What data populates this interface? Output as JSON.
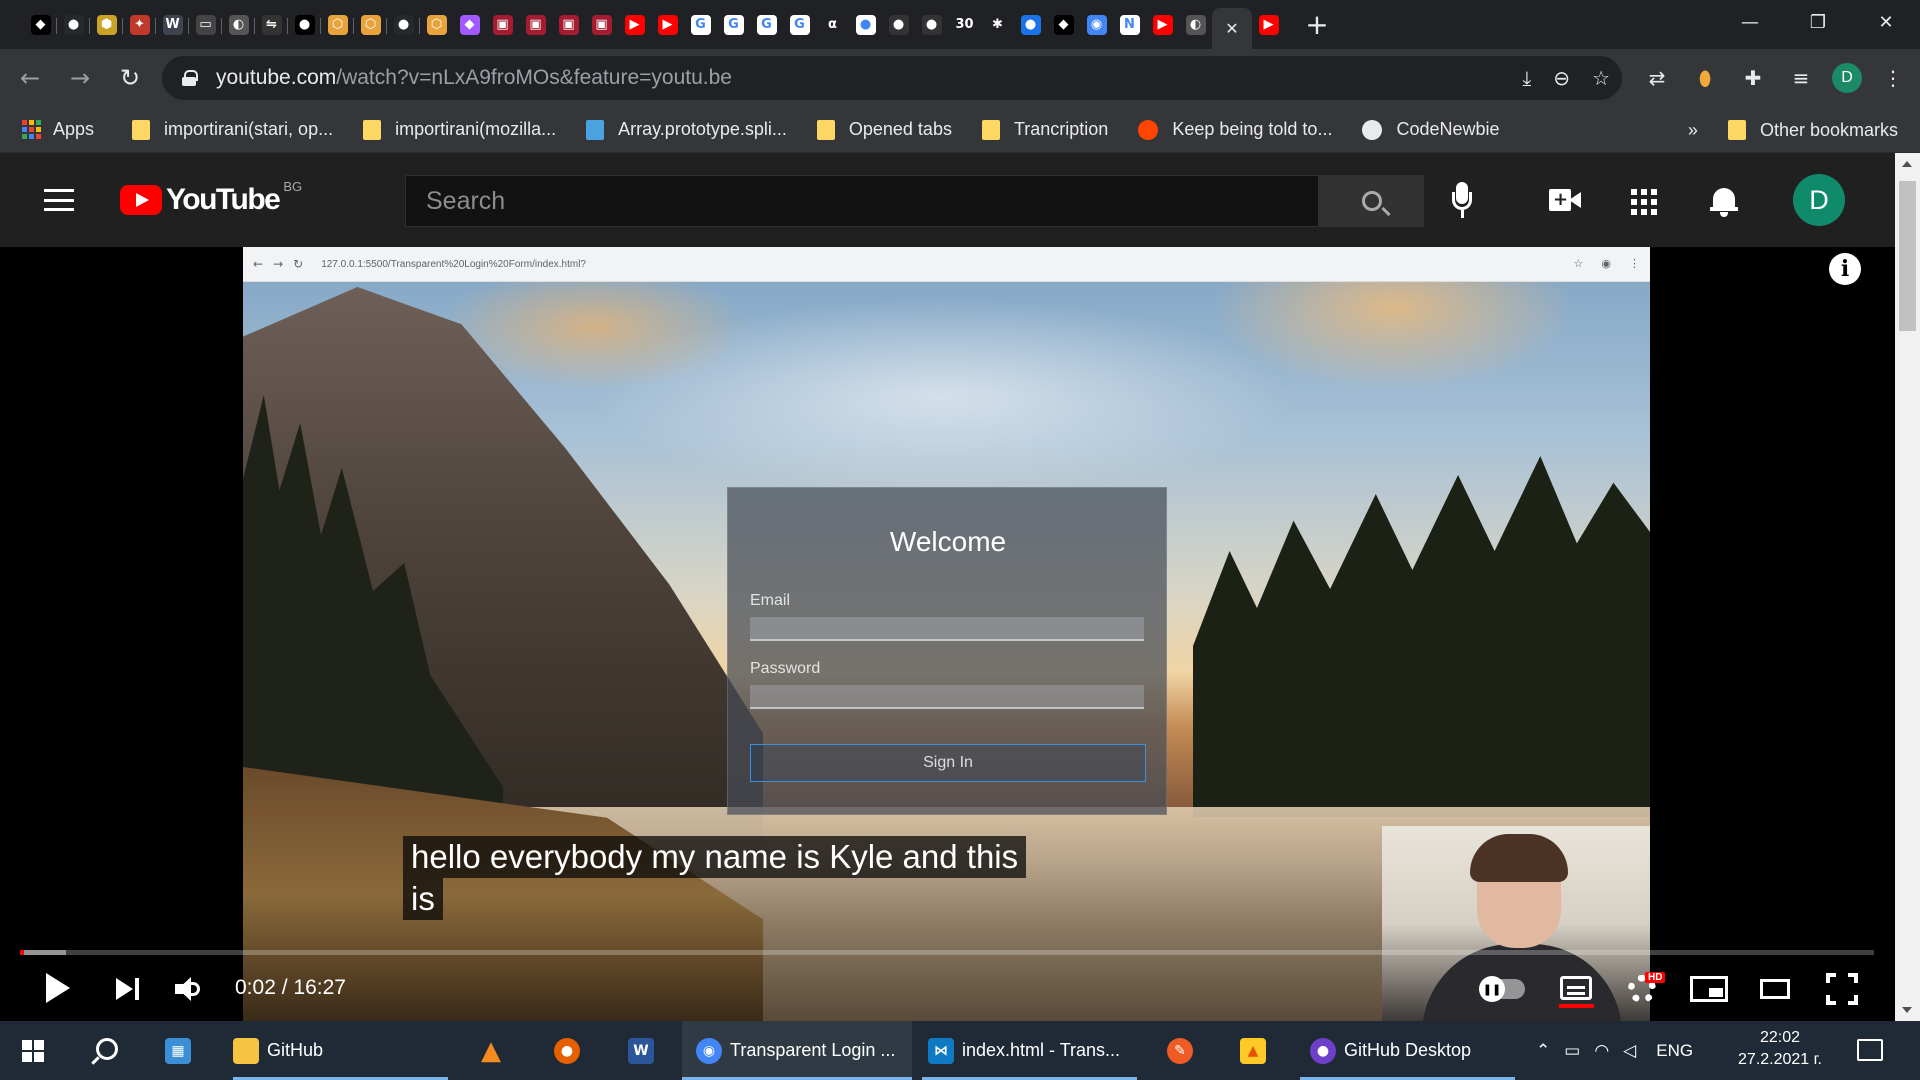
{
  "browser": {
    "favicon_tabs": [
      {
        "icon": "kodi-icon",
        "glyph": "◆",
        "bg": "#000000"
      },
      {
        "icon": "github-icon",
        "glyph": "●",
        "bg": "#24292e"
      },
      {
        "icon": "js-hexagon-icon",
        "glyph": "⬢",
        "bg": "#c9a227"
      },
      {
        "icon": "figure-icon",
        "glyph": "✦",
        "bg": "#c0392b"
      },
      {
        "icon": "w3schools-icon",
        "glyph": "W",
        "bg": "#3d4450"
      },
      {
        "icon": "keyboard-icon",
        "glyph": "▭",
        "bg": "#444444"
      },
      {
        "icon": "globe-icon",
        "glyph": "◐",
        "bg": "#555555"
      },
      {
        "icon": "arrows-icon",
        "glyph": "⇋",
        "bg": "#333333"
      },
      {
        "icon": "medium-icon",
        "glyph": "●",
        "bg": "#000000"
      },
      {
        "icon": "hexagon-icon",
        "glyph": "⬡",
        "bg": "#e8a33d"
      },
      {
        "icon": "hexagon-icon",
        "glyph": "⬡",
        "bg": "#e8a33d"
      },
      {
        "icon": "github-icon",
        "glyph": "●",
        "bg": "#24292e"
      },
      {
        "icon": "hexagon-icon",
        "glyph": "⬡",
        "bg": "#e8a33d"
      },
      {
        "icon": "figma-icon",
        "glyph": "◆",
        "bg": "#a259ff"
      },
      {
        "icon": "harvard-icon",
        "glyph": "▣",
        "bg": "#a51c30"
      },
      {
        "icon": "harvard-icon",
        "glyph": "▣",
        "bg": "#a51c30"
      },
      {
        "icon": "harvard-icon",
        "glyph": "▣",
        "bg": "#a51c30"
      },
      {
        "icon": "harvard-icon",
        "glyph": "▣",
        "bg": "#a51c30"
      },
      {
        "icon": "youtube-icon",
        "glyph": "▶",
        "bg": "#ff0000"
      },
      {
        "icon": "youtube-icon",
        "glyph": "▶",
        "bg": "#ff0000"
      },
      {
        "icon": "google-icon",
        "glyph": "G",
        "bg": "#ffffff"
      },
      {
        "icon": "google-icon",
        "glyph": "G",
        "bg": "#ffffff"
      },
      {
        "icon": "google-icon",
        "glyph": "G",
        "bg": "#ffffff"
      },
      {
        "icon": "google-icon",
        "glyph": "G",
        "bg": "#ffffff"
      },
      {
        "icon": "alpha-icon",
        "glyph": "α",
        "bg": "#202124"
      },
      {
        "icon": "record-icon",
        "glyph": "●",
        "bg": "#ffffff"
      },
      {
        "icon": "github-icon",
        "glyph": "●",
        "bg": "#333333"
      },
      {
        "icon": "github-icon",
        "glyph": "●",
        "bg": "#333333"
      },
      {
        "icon": "thirty-icon",
        "glyph": "30",
        "bg": "#202124"
      },
      {
        "icon": "asterisk-icon",
        "glyph": "✱",
        "bg": "#202124"
      },
      {
        "icon": "drop-icon",
        "glyph": "●",
        "bg": "#1a73e8"
      },
      {
        "icon": "kodi-icon",
        "glyph": "◆",
        "bg": "#000000"
      },
      {
        "icon": "chrome-icon",
        "glyph": "◉",
        "bg": "#4285f4"
      },
      {
        "icon": "notion-icon",
        "glyph": "N",
        "bg": "#ffffff"
      },
      {
        "icon": "youtube-icon",
        "glyph": "▶",
        "bg": "#ff0000"
      },
      {
        "icon": "globe-icon",
        "glyph": "◐",
        "bg": "#555555"
      }
    ],
    "close_tab_glyph": "✕",
    "active_tab_icon": "youtube-icon",
    "new_tab_glyph": "+",
    "window": {
      "minimize": "—",
      "restore": "❐",
      "close": "✕"
    },
    "url_host": "youtube.com",
    "url_path": "/watch?v=nLxA9froMOs&feature=youtu.be",
    "profile_initial": "D",
    "bookmarks": [
      {
        "label": "importirani(stari, op...",
        "icon": "folder-icon"
      },
      {
        "label": "importirani(mozilla...",
        "icon": "folder-icon"
      },
      {
        "label": "Array.prototype.spli...",
        "icon": "mdn-icon"
      },
      {
        "label": "Opened tabs",
        "icon": "folder-icon"
      },
      {
        "label": "Trancription",
        "icon": "folder-icon"
      },
      {
        "label": "Keep being told to...",
        "icon": "reddit-icon"
      },
      {
        "label": "CodeNewbie",
        "icon": "globe-icon"
      }
    ],
    "apps_label": "Apps",
    "more_bookmarks": "»",
    "other_bookmarks": "Other bookmarks"
  },
  "youtube": {
    "logo_text": "YouTube",
    "region": "BG",
    "search_placeholder": "Search",
    "avatar_initial": "D",
    "info_glyph": "i"
  },
  "video": {
    "inner_url": "127.0.0.1:5500/Transparent%20Login%20Form/index.html?",
    "login": {
      "title": "Welcome",
      "email_label": "Email",
      "password_label": "Password",
      "button": "Sign In"
    },
    "captions": [
      "hello everybody my name is Kyle and this",
      "is"
    ],
    "time_current": "0:02",
    "time_total": "16:27",
    "time_separator": " / ",
    "played_fraction": 0.002,
    "loaded_fraction": 0.025,
    "hd_badge": "HD",
    "autoplay_glyph": "❚❚"
  },
  "taskbar": {
    "items": [
      {
        "label": "GitHub",
        "icon": "folder-icon"
      },
      {
        "label": "Transparent Login ...",
        "icon": "chrome-icon"
      },
      {
        "label": "index.html - Trans...",
        "icon": "vscode-icon"
      },
      {
        "label": "GitHub Desktop",
        "icon": "github-desktop-icon"
      }
    ],
    "language": "ENG",
    "time": "22:02",
    "date": "27.2.2021 г."
  }
}
